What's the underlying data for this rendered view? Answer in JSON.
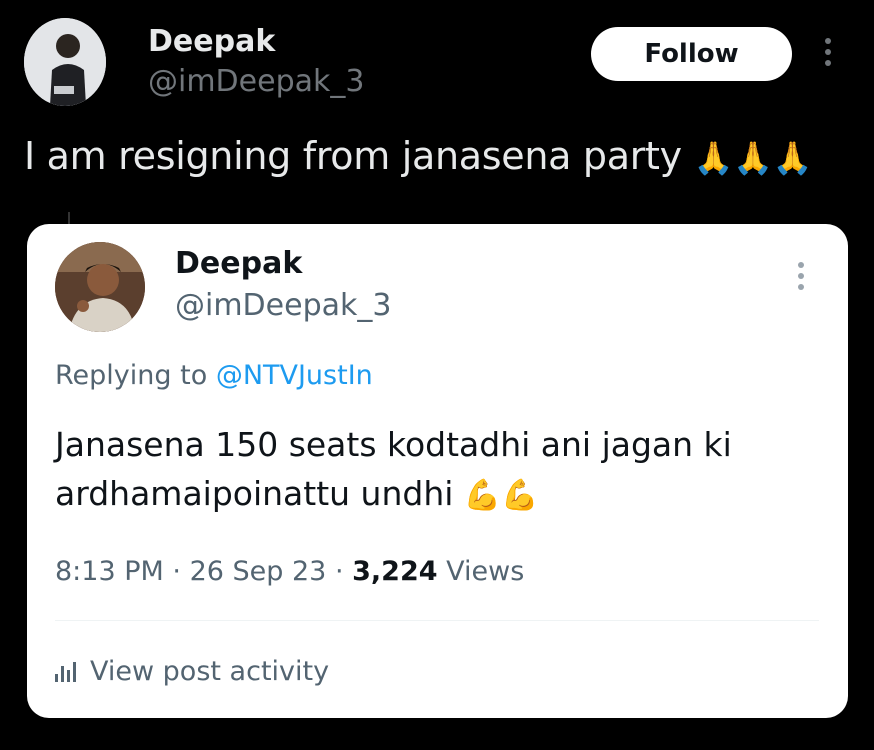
{
  "post": {
    "author_name": "Deepak",
    "author_handle": "@imDeepak_3",
    "follow_label": "Follow",
    "text": "I am resigning from janasena party",
    "emojis": "🙏🙏🙏"
  },
  "quoted": {
    "author_name": "Deepak",
    "author_handle": "@imDeepak_3",
    "replying_prefix": "Replying to",
    "replying_to": "@NTVJustIn",
    "text_line1": "Janasena 150 seats kodtadhi ani jagan ki",
    "text_line2": "ardhamaipoinattu undhi",
    "emojis": "💪💪",
    "time": "8:13 PM",
    "date": "26 Sep 23",
    "views_count": "3,224",
    "views_label": "Views",
    "activity_label": "View post activity"
  },
  "icons": {
    "more": "more-vertical-icon",
    "activity": "bar-chart-icon"
  },
  "colors": {
    "background": "#000000",
    "card": "#ffffff",
    "link": "#1d9bf0",
    "secondary_text": "#536471"
  }
}
